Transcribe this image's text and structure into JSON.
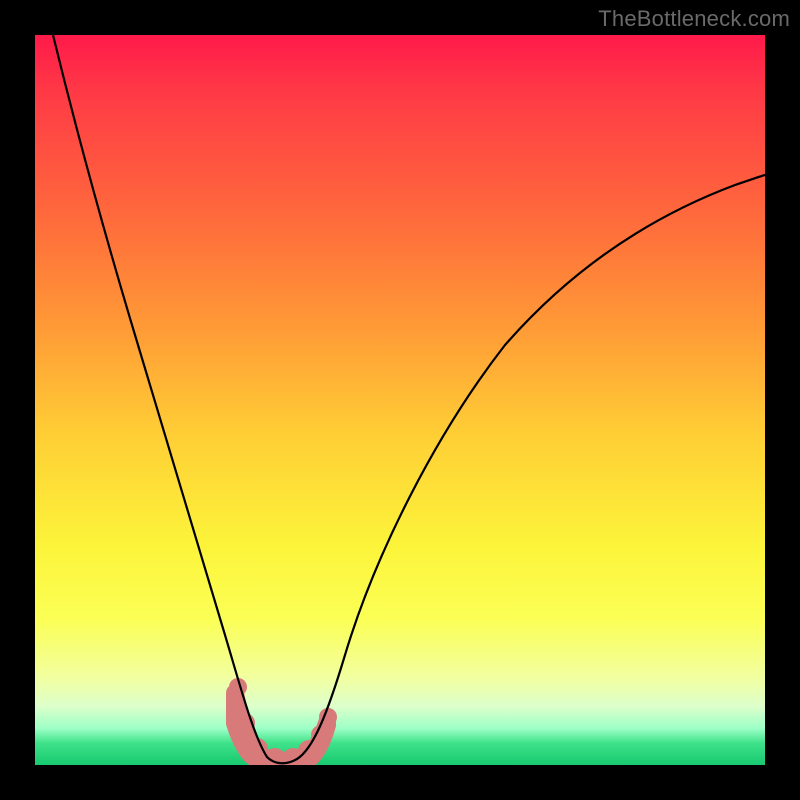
{
  "watermark": "TheBottleneck.com",
  "chart_data": {
    "type": "line",
    "title": "",
    "xlabel": "",
    "ylabel": "",
    "xlim": [
      0,
      100
    ],
    "ylim": [
      0,
      100
    ],
    "grid": false,
    "legend": false,
    "series": [
      {
        "name": "bottleneck-curve",
        "x": [
          2,
          6,
          10,
          14,
          18,
          22,
          26,
          28,
          30,
          32,
          34,
          36,
          38,
          42,
          48,
          56,
          66,
          78,
          90,
          100
        ],
        "y": [
          100,
          87,
          75,
          64,
          53,
          42,
          28,
          18,
          8,
          3,
          1,
          1,
          3,
          10,
          22,
          36,
          50,
          62,
          72,
          78
        ]
      },
      {
        "name": "highlight-band",
        "x": [
          27,
          28,
          29,
          30,
          31,
          32,
          33,
          34,
          35,
          36,
          37,
          38,
          39
        ],
        "y": [
          10,
          7,
          4,
          2,
          1,
          1,
          1,
          1,
          1,
          1,
          2,
          3,
          5
        ]
      }
    ],
    "colors": {
      "curve": "#000000",
      "highlight": "#d97a7a",
      "gradient_top": "#ff1a4a",
      "gradient_bottom": "#17c96f"
    },
    "annotations": []
  }
}
